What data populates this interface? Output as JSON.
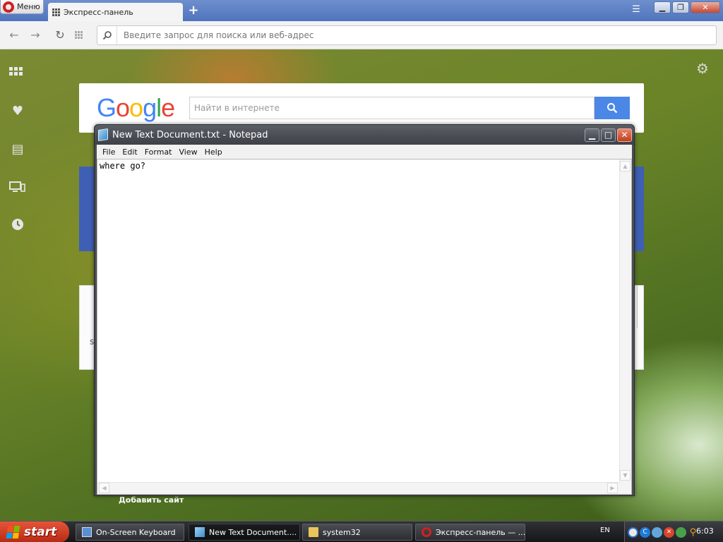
{
  "browser": {
    "menu_label": "Меню",
    "tab_title": "Экспресс-панель",
    "address_placeholder": "Введите запрос для поиска или веб-адрес"
  },
  "speed_dial": {
    "google_logo": [
      "G",
      "o",
      "o",
      "g",
      "l",
      "e"
    ],
    "search_placeholder": "Найти в интернете",
    "tile_fragment": "s",
    "add_site_label": "Добавить сайт"
  },
  "notepad": {
    "title": "New Text Document.txt - Notepad",
    "menu": [
      "File",
      "Edit",
      "Format",
      "View",
      "Help"
    ],
    "content": "where go?"
  },
  "taskbar": {
    "start_label": "start",
    "tasks": [
      {
        "label": "On-Screen Keyboard"
      },
      {
        "label": "New Text Document...."
      },
      {
        "label": "system32"
      },
      {
        "label": "Экспресс-панель — ..."
      }
    ],
    "language": "EN",
    "clock": "6:03"
  },
  "colors": {
    "opera_red": "#d1201f",
    "google_blue": "#4285f4",
    "speed_dial_blue": "#3f5fb5",
    "start_red": "#d13f22"
  }
}
